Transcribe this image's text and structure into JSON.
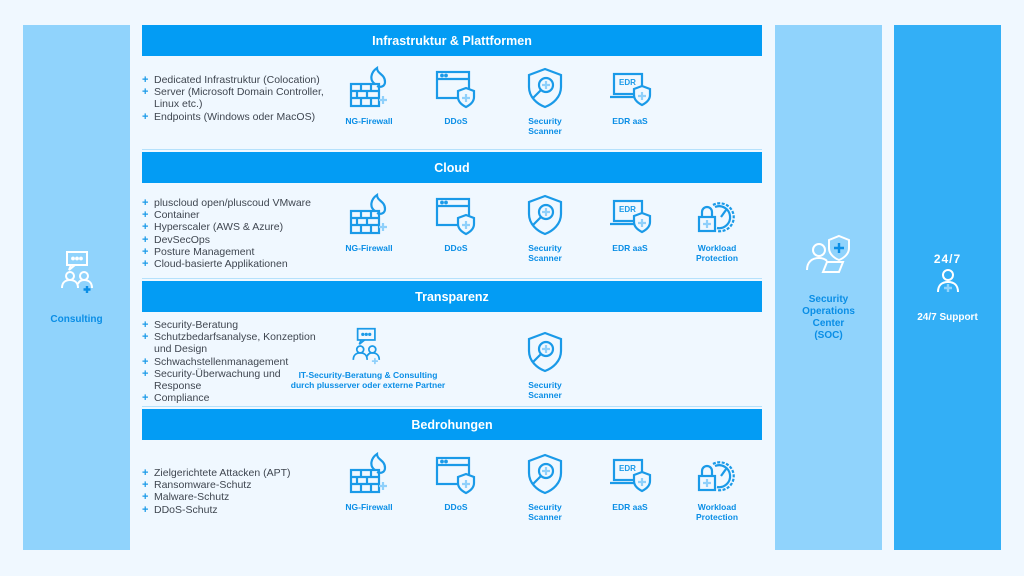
{
  "colors": {
    "background": "#f0f8ff",
    "header": "#039cf4",
    "light_column": "#90d3fc",
    "support_column": "#33aff6",
    "accent_text": "#0a8ee6"
  },
  "left_column": {
    "label": "Consulting",
    "icon": "consulting-chat-people-icon"
  },
  "soc_column": {
    "label_lines": [
      "Security",
      "Operations",
      "Center",
      "(SOC)"
    ],
    "icon": "soc-analyst-shield-icon"
  },
  "support_column": {
    "top_label": "24/7",
    "label": "24/7 Support",
    "icon": "support-person-plus-icon"
  },
  "sections": [
    {
      "title": "Infrastruktur & Plattformen",
      "bullets": [
        "Dedicated Infrastruktur (Colocation)",
        "Server (Microsoft Domain Controller, Linux etc.)",
        "Endpoints (Windows oder MacOS)"
      ],
      "tools": [
        {
          "label": "NG-Firewall",
          "icon": "firewall-icon"
        },
        {
          "label": "DDoS",
          "icon": "ddos-window-shield-icon"
        },
        {
          "label": "Security Scanner",
          "icon": "security-scanner-icon"
        },
        {
          "label": "EDR aaS",
          "icon": "edr-laptop-icon"
        }
      ]
    },
    {
      "title": "Cloud",
      "bullets": [
        "pluscloud open/pluscoud VMware",
        "Container",
        "Hyperscaler (AWS & Azure)",
        "DevSecOps",
        "Posture Management",
        "Cloud-basierte Applikationen"
      ],
      "tools": [
        {
          "label": "NG-Firewall",
          "icon": "firewall-icon"
        },
        {
          "label": "DDoS",
          "icon": "ddos-window-shield-icon"
        },
        {
          "label": "Security Scanner",
          "icon": "security-scanner-icon"
        },
        {
          "label": "EDR aaS",
          "icon": "edr-laptop-icon"
        },
        {
          "label": "Workload Protection",
          "icon": "workload-protection-icon"
        }
      ]
    },
    {
      "title": "Transparenz",
      "bullets": [
        "Security-Beratung",
        "Schutzbedarfsanalyse, Konzeption und Design",
        "Schwachstellenmanagement",
        "Security-Überwachung und Response",
        "Compliance"
      ],
      "tools": [
        {
          "label_lines": [
            "IT-Security-Beratung & Consulting",
            "durch plusserver oder externe Partner"
          ],
          "icon": "consulting-icon"
        },
        {
          "label": "Security Scanner",
          "icon": "security-scanner-icon"
        }
      ]
    },
    {
      "title": "Bedrohungen",
      "bullets": [
        "Zielgerichtete Attacken (APT)",
        "Ransomware-Schutz",
        "Malware-Schutz",
        "DDoS-Schutz"
      ],
      "tools": [
        {
          "label": "NG-Firewall",
          "icon": "firewall-icon"
        },
        {
          "label": "DDoS",
          "icon": "ddos-window-shield-icon"
        },
        {
          "label": "Security Scanner",
          "icon": "security-scanner-icon"
        },
        {
          "label": "EDR aaS",
          "icon": "edr-laptop-icon"
        },
        {
          "label": "Workload Protection",
          "icon": "workload-protection-icon"
        }
      ]
    }
  ]
}
